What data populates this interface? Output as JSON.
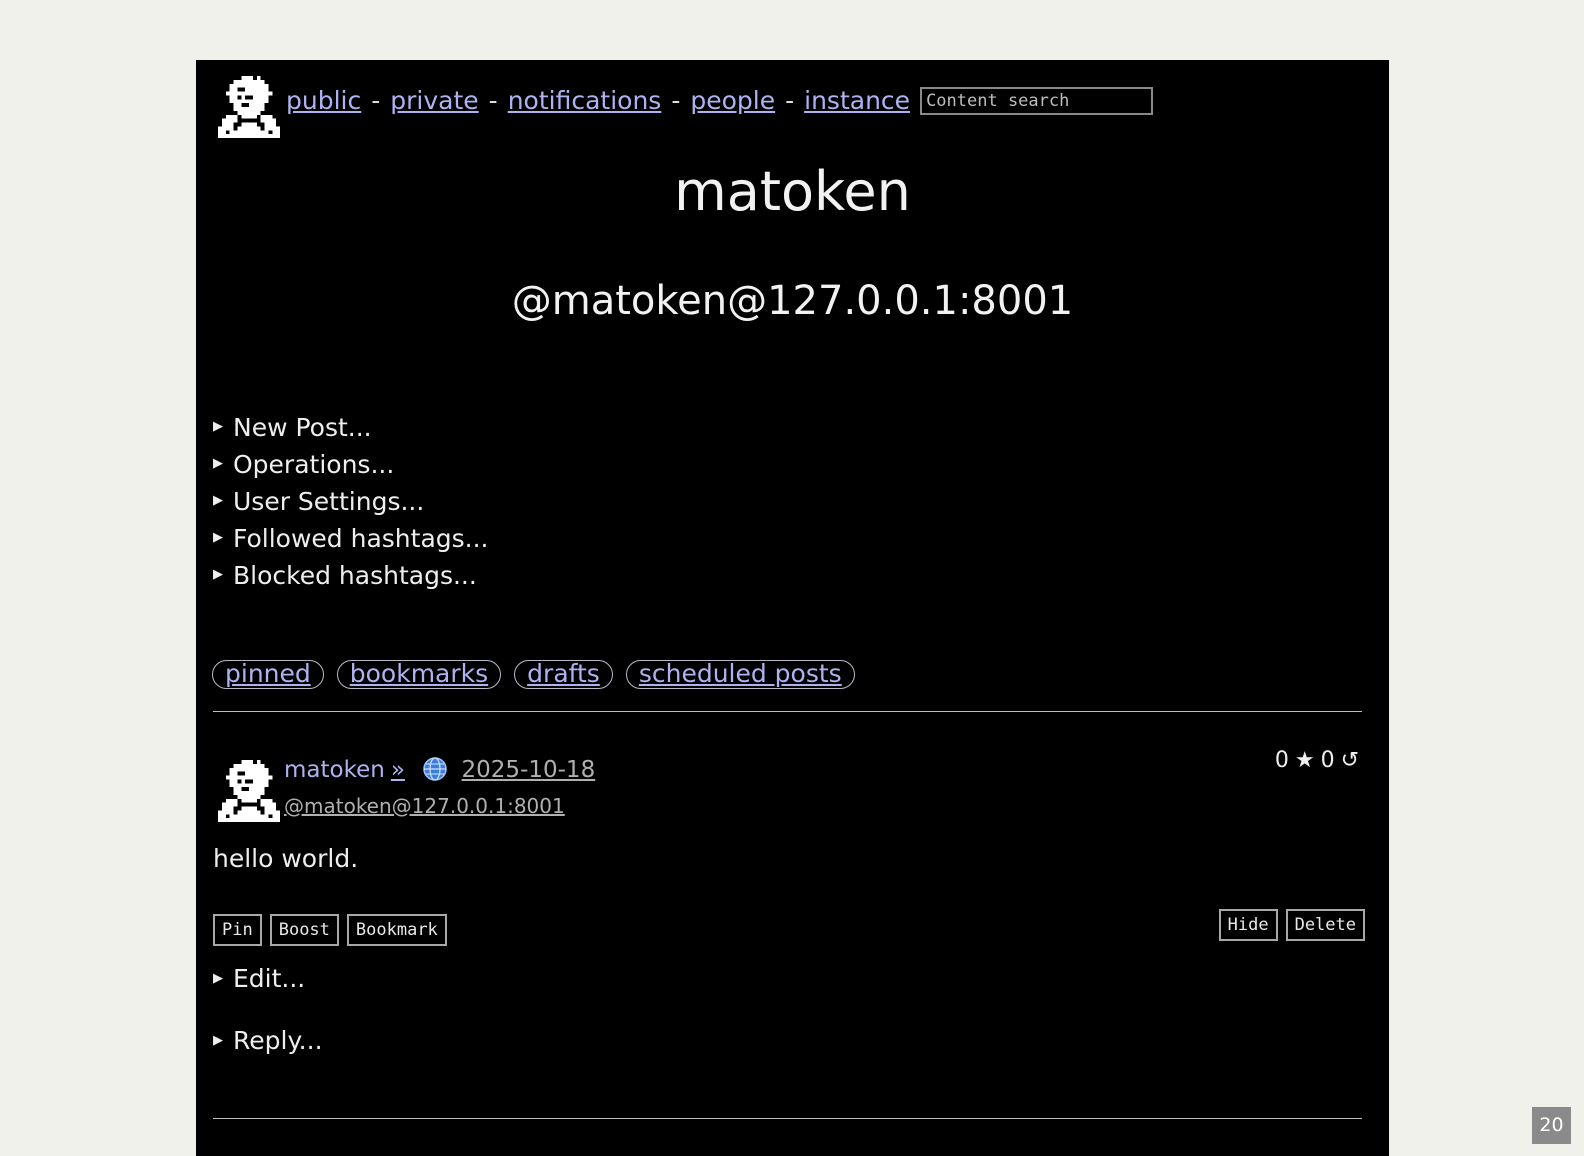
{
  "nav": {
    "links": [
      "public",
      "private",
      "notifications",
      "people",
      "instance"
    ],
    "separator": "-",
    "search_placeholder": "Content search"
  },
  "profile": {
    "name": "matoken",
    "handle": "@matoken@127.0.0.1:8001"
  },
  "menus": [
    "New Post...",
    "Operations...",
    "User Settings...",
    "Followed hashtags...",
    "Blocked hashtags..."
  ],
  "tabs": [
    "pinned",
    "bookmarks",
    "drafts",
    "scheduled posts"
  ],
  "post": {
    "author": "matoken",
    "raquo": "»",
    "date": "2025-10-18",
    "acct": "@matoken@127.0.0.1:8001",
    "likes": "0",
    "like_symbol": "★",
    "boosts": "0",
    "boost_symbol": "↺",
    "content": "hello world.",
    "actions_left": [
      "Pin",
      "Boost",
      "Bookmark"
    ],
    "actions_right": [
      "Hide",
      "Delete"
    ],
    "edit_label": "Edit...",
    "reply_label": "Reply..."
  },
  "page_badge": "20",
  "colors": {
    "background": "#000000",
    "link": "#aeb2f0",
    "outer": "#f1f1ec"
  }
}
